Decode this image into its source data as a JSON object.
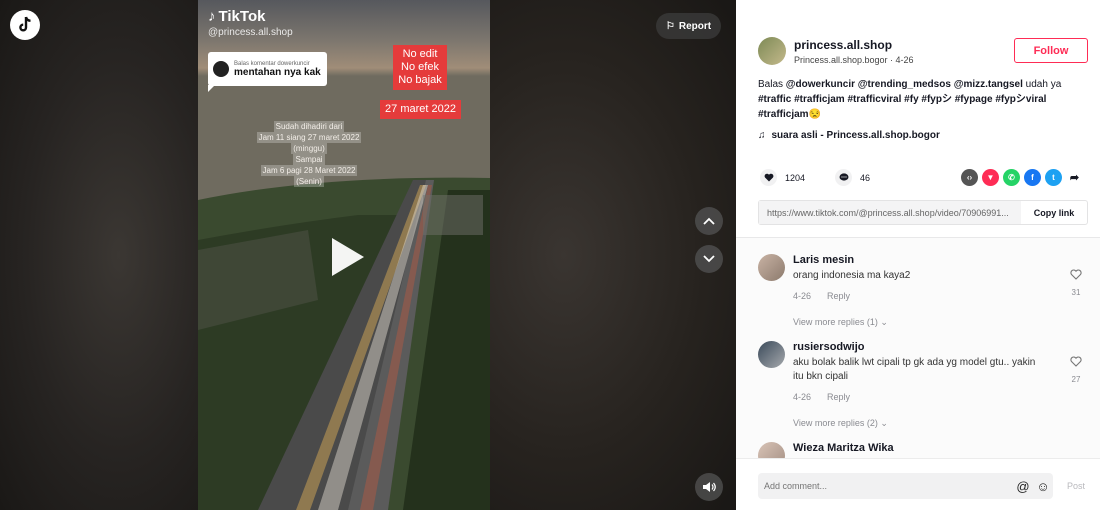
{
  "video": {
    "watermark_brand": "TikTok",
    "watermark_handle": "@princess.all.shop",
    "reply_bubble": {
      "label": "Balas komentar dowerkuncir",
      "text": "mentahan nya kak"
    },
    "overlay_no_edit": [
      "No edit",
      "No efek",
      "No bajak"
    ],
    "date_badge": "27 maret 2022",
    "fade_lines": [
      "Sudah dihadiri dari",
      "Jam 11 siang 27 maret 2022",
      "(minggu)",
      "Sampai",
      "Jam 6 pagi 28 Maret 2022",
      "(Senin)"
    ],
    "report_label": "Report"
  },
  "panel": {
    "author_name": "princess.all.shop",
    "author_sub": "Princess.all.shop.bogor · 4-26",
    "follow_label": "Follow",
    "caption": {
      "prefix": "Balas ",
      "mentions": [
        "@dowerkuncir",
        "@trending_medsos",
        "@mizz.tangsel"
      ],
      "mid": " udah ya",
      "hashtags": "#traffic #trafficjam #trafficviral #fy #fypシ #fypage #fypシviral #trafficjam😒"
    },
    "music": "suara asli - Princess.all.shop.bogor",
    "likes": "1204",
    "comments_count": "46",
    "link_url": "https://www.tiktok.com/@princess.all.shop/video/70906991...",
    "copy_link_label": "Copy link",
    "comments": [
      {
        "name": "Laris mesin",
        "text": "orang indonesia ma kaya2",
        "date": "4-26",
        "reply": "Reply",
        "likes": "31",
        "more": "View more replies (1) ⌄"
      },
      {
        "name": "rusiersodwijo",
        "text": "aku bolak balik lwt cipali tp gk ada yg model gtu.. yakin itu bkn cipali",
        "date": "4-26",
        "reply": "Reply",
        "likes": "27",
        "more": "View more replies (2) ⌄"
      },
      {
        "name": "Wieza Maritza Wika"
      }
    ],
    "comment_placeholder": "Add comment...",
    "post_label": "Post"
  }
}
